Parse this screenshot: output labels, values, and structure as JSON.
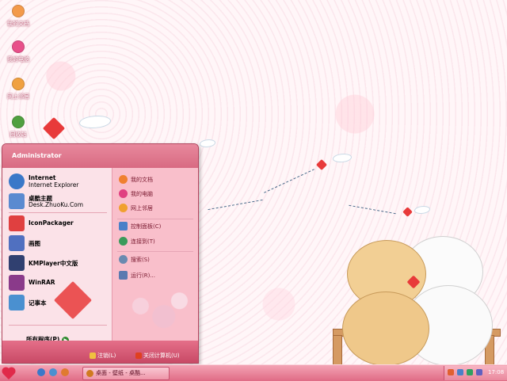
{
  "desktop": {
    "icons": [
      {
        "label": "我的文档",
        "color": "#f39a4a"
      },
      {
        "label": "我的电脑",
        "color": "#e8508a"
      },
      {
        "label": "网上邻居",
        "color": "#f0a040"
      },
      {
        "label": "回收站",
        "color": "#50a040"
      }
    ]
  },
  "start_menu": {
    "user": "Administrator",
    "pinned": [
      {
        "title": "Internet",
        "subtitle": "Internet Explorer",
        "icon": "internet-explorer-icon",
        "color": "#3a78c8"
      },
      {
        "title": "桌酷主题",
        "subtitle": "Desk.ZhuoKu.Com",
        "icon": "zhuoku-theme-icon",
        "color": "#5a8ad0"
      }
    ],
    "programs": [
      {
        "label": "IconPackager",
        "icon": "iconpackager-icon",
        "color": "#e04040"
      },
      {
        "label": "画图",
        "icon": "paint-icon",
        "color": "#5070c0"
      },
      {
        "label": "KMPlayer中文版",
        "icon": "kmplayer-icon",
        "color": "#304070"
      },
      {
        "label": "WinRAR",
        "icon": "winrar-icon",
        "color": "#8a3a8a"
      },
      {
        "label": "记事本",
        "icon": "notepad-icon",
        "color": "#4a90d0"
      }
    ],
    "all_programs": "所有程序(P)",
    "right_items": [
      {
        "label": "我的文档",
        "icon": "my-documents-icon",
        "color": "#f08030"
      },
      {
        "label": "我的电脑",
        "icon": "my-computer-icon",
        "color": "#e04080"
      },
      {
        "label": "网上邻居",
        "icon": "network-icon",
        "color": "#f0a030"
      }
    ],
    "system_items": [
      {
        "label": "控制面板(C)",
        "icon": "control-panel-icon",
        "color": "#4a80c8"
      },
      {
        "label": "连接到(T)",
        "icon": "connect-icon",
        "color": "#3a9a5a"
      },
      {
        "label": "搜索(S)",
        "icon": "search-icon",
        "color": "#6a8ab0"
      },
      {
        "label": "运行(R)...",
        "icon": "run-icon",
        "color": "#5a7ab0"
      }
    ],
    "logoff": "注销(L)",
    "shutdown": "关闭计算机(U)"
  },
  "taskbar": {
    "task_label": "桌面 - 壁纸 - 桌酷...",
    "clock": "17:08",
    "quick_launch": [
      "#3a78c8",
      "#4a90d0",
      "#e07a30"
    ],
    "tray_colors": [
      "#e06030",
      "#4a80c8",
      "#30a060",
      "#6060c0"
    ]
  }
}
